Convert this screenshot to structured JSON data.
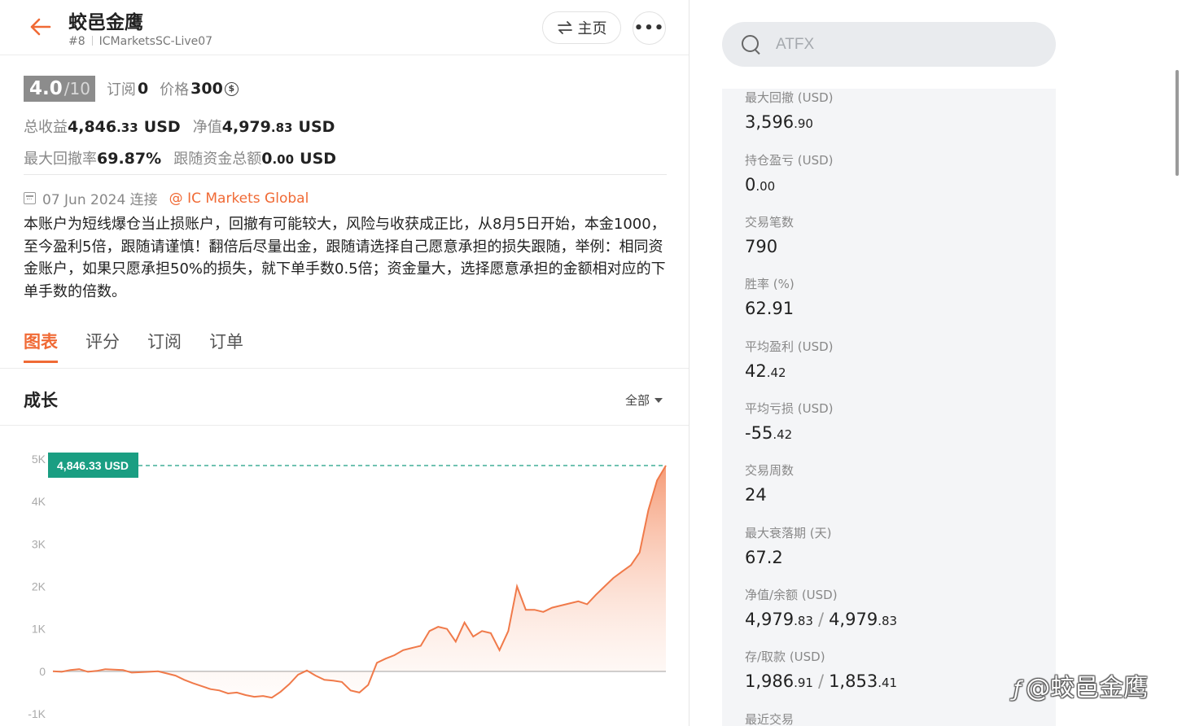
{
  "header": {
    "title": "蛟邑金鹰",
    "rank": "#8",
    "account": "ICMarketsSC-Live07",
    "home_label": "主页",
    "more_label": "•••"
  },
  "summary": {
    "rating": "4.0",
    "rating_max": "/10",
    "subscribe_label": "订阅",
    "subscribe_value": "0",
    "price_label": "价格",
    "price_value": "300",
    "price_icon": "coin-icon",
    "total_profit_label": "总收益",
    "total_profit_int": "4,846",
    "total_profit_dec": ".33",
    "total_profit_unit": "USD",
    "equity_label": "净值",
    "equity_int": "4,979",
    "equity_dec": ".83",
    "equity_unit": "USD",
    "max_dd_label": "最大回撤率",
    "max_dd_value": "69.87%",
    "follow_label": "跟随资金总额",
    "follow_int": "0",
    "follow_dec": ".00",
    "follow_unit": "USD"
  },
  "info": {
    "date": "07 Jun 2024 连接",
    "broker": "@ IC Markets Global",
    "description": "本账户为短线爆仓当止损账户，回撤有可能较大，风险与收获成正比，从8月5日开始，本金1000，至今盈利5倍，跟随请谨慎！翻倍后尽量出金，跟随请选择自己愿意承担的损失跟随，举例：相同资金账户，如果只愿承担50%的损失，就下单手数0.5倍；资金量大，选择愿意承担的金额相对应的下单手数的倍数。"
  },
  "tabs": [
    {
      "label": "图表",
      "active": true
    },
    {
      "label": "评分",
      "active": false
    },
    {
      "label": "订阅",
      "active": false
    },
    {
      "label": "订单",
      "active": false
    }
  ],
  "growth": {
    "title": "成长",
    "range_label": "全部"
  },
  "chart_data": {
    "type": "area",
    "title": "",
    "xlabel": "",
    "ylabel": "",
    "ylim": [
      -1000,
      5000
    ],
    "yticks": [
      "5K",
      "4K",
      "3K",
      "2K",
      "1K",
      "0",
      "-1K"
    ],
    "ytick_values": [
      5000,
      4000,
      3000,
      2000,
      1000,
      0,
      -1000
    ],
    "current_label": "4,846.33 USD",
    "current_value": 4846.33,
    "line_color": "#f07a4a",
    "label_color": "#1a9e82",
    "series": [
      {
        "values": [
          0,
          -10,
          30,
          50,
          -10,
          10,
          50,
          40,
          30,
          -30,
          -20,
          -10,
          0,
          -50,
          -100,
          -200,
          -280,
          -350,
          -420,
          -450,
          -520,
          -500,
          -560,
          -600,
          -580,
          -620,
          -480,
          -300,
          -80,
          20,
          -100,
          -200,
          -220,
          -250,
          -450,
          -500,
          -320,
          200,
          300,
          380,
          500,
          550,
          600,
          950,
          1050,
          1000,
          700,
          1150,
          820,
          950,
          900,
          500,
          950,
          2000,
          1450,
          1450,
          1400,
          1500,
          1550,
          1600,
          1650,
          1580,
          1800,
          2000,
          2200,
          2350,
          2500,
          2800,
          3800,
          4500,
          4846
        ]
      }
    ]
  },
  "search": {
    "placeholder": "ATFX"
  },
  "stats": [
    {
      "label": "最大回撤 (USD)",
      "int": "3,596",
      "dec": ".90"
    },
    {
      "label": "持仓盈亏 (USD)",
      "int": "0",
      "dec": ".00"
    },
    {
      "label": "交易笔数",
      "int": "790",
      "dec": ""
    },
    {
      "label": "胜率 (%)",
      "int": "62.91",
      "dec": ""
    },
    {
      "label": "平均盈利 (USD)",
      "int": "42",
      "dec": ".42"
    },
    {
      "label": "平均亏损 (USD)",
      "int": "-55",
      "dec": ".42"
    },
    {
      "label": "交易周数",
      "int": "24",
      "dec": ""
    },
    {
      "label": "最大衰落期 (天)",
      "int": "67.2",
      "dec": ""
    },
    {
      "label": "净值/余额 (USD)",
      "int": "4,979",
      "dec": ".83",
      "int2": "4,979",
      "dec2": ".83"
    },
    {
      "label": "存/取款 (USD)",
      "int": "1,986",
      "dec": ".91",
      "int2": "1,853",
      "dec2": ".41"
    },
    {
      "label": "最近交易",
      "int": "",
      "dec": ""
    }
  ],
  "watermark": "@蛟邑金鹰"
}
